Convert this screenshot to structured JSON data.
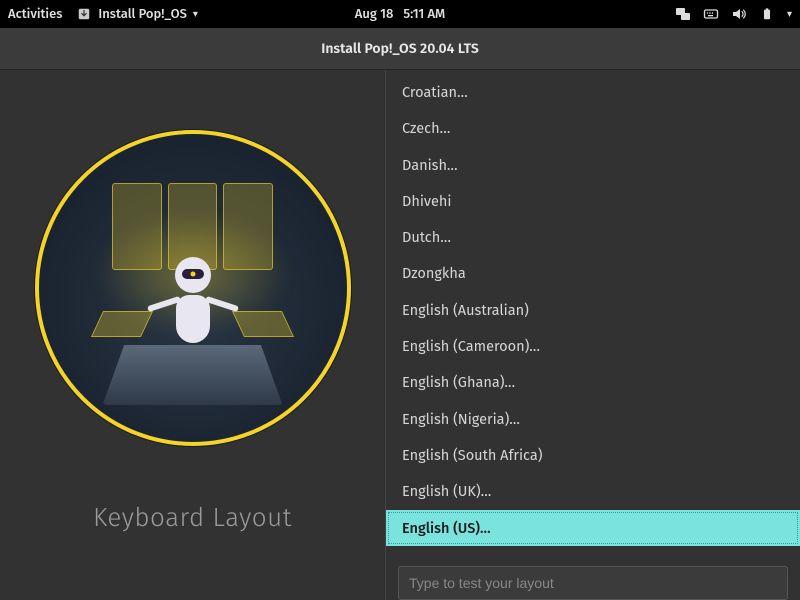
{
  "topbar": {
    "activities": "Activities",
    "app_label": "Install Pop!_OS",
    "date": "Aug 18",
    "time": "5:11 AM"
  },
  "window": {
    "title": "Install Pop!_OS 20.04 LTS"
  },
  "left": {
    "heading": "Keyboard Layout"
  },
  "layouts": [
    "Croatian…",
    "Czech…",
    "Danish…",
    "Dhivehi",
    "Dutch…",
    "Dzongkha",
    "English (Australian)",
    "English (Cameroon)…",
    "English (Ghana)…",
    "English (Nigeria)…",
    "English (South Africa)",
    "English (UK)…",
    "English (US)…"
  ],
  "selected_index": 12,
  "test_placeholder": "Type to test your layout"
}
